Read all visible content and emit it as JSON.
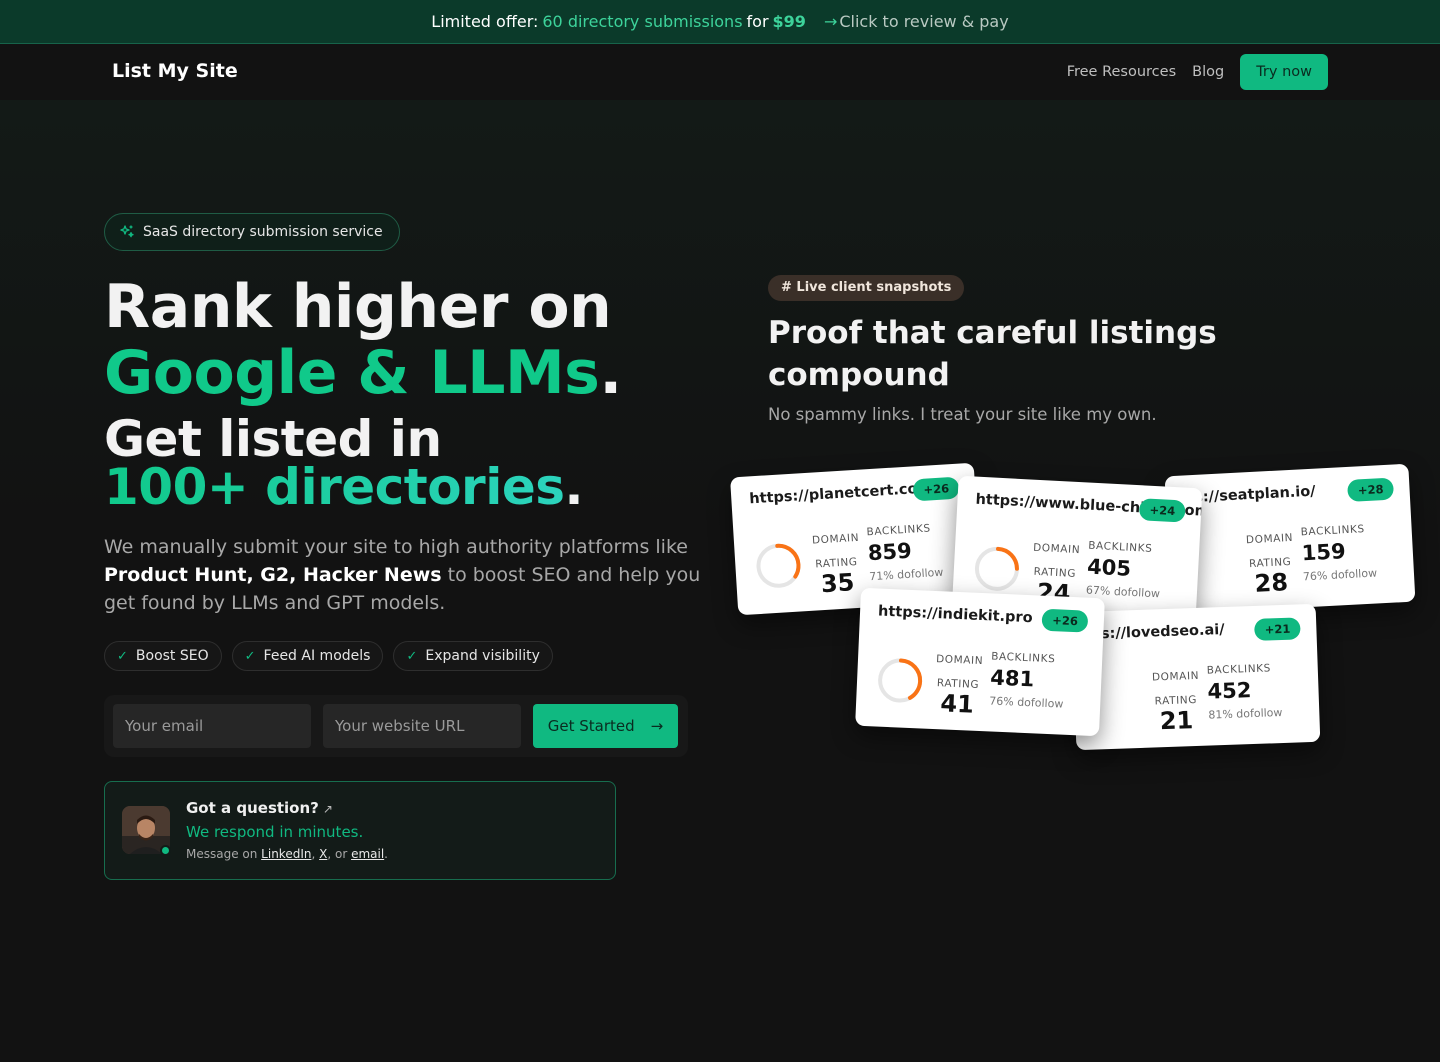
{
  "promo": {
    "prefix": "Limited offer:",
    "offer": "60 directory submissions",
    "for": "for",
    "price": "$99",
    "cta": "Click to review & pay"
  },
  "nav": {
    "brand": "List My Site",
    "links": [
      "Free Resources",
      "Blog"
    ],
    "cta": "Try now"
  },
  "hero": {
    "badge": "SaaS directory submission service",
    "headline_line1": "Rank higher on",
    "headline_line2": "Google & LLMs",
    "headline_line3": "Get listed in",
    "headline_line4": "100+ directories",
    "dot": ".",
    "desc_before": "We manually submit your site to high authority platforms like ",
    "desc_bold": "Product Hunt, G2, Hacker News",
    "desc_after": " to boost SEO and help you get found by LLMs and GPT models.",
    "pills": [
      "Boost SEO",
      "Feed AI models",
      "Expand visibility"
    ],
    "form": {
      "email_placeholder": "Your email",
      "url_placeholder": "Your website URL",
      "submit": "Get Started"
    }
  },
  "question": {
    "title": "Got a question?",
    "subtitle": "We respond in minutes.",
    "message_prefix": "Message on ",
    "link_linkedin": "LinkedIn",
    "sep1": ", ",
    "link_x": "X",
    "sep2": ", or ",
    "link_email": "email",
    "suffix": "."
  },
  "proof": {
    "badge": "# Live client snapshots",
    "title": "Proof that careful listings compound",
    "subtitle": "No spammy links. I treat your site like my own.",
    "labels": {
      "domain": "DOMAIN",
      "rating": "RATING",
      "backlinks": "BACKLINKS",
      "dofollow_suffix": "dofollow"
    },
    "cards": [
      {
        "url": "https://planetcert.com/",
        "delta": "+26",
        "rating": "35",
        "rating_fill": 0.35,
        "backlinks": "859",
        "dofollow": "71% dofollow"
      },
      {
        "url": "https://seatplan.io/",
        "delta": "+28",
        "rating": "28",
        "rating_fill": 0.28,
        "backlinks": "159",
        "dofollow": "76% dofollow"
      },
      {
        "url": "https://www.blue-chimp.com/",
        "delta": "+24",
        "rating": "24",
        "rating_fill": 0.24,
        "backlinks": "405",
        "dofollow": "67% dofollow"
      },
      {
        "url": "https://lovedseo.ai/",
        "delta": "+21",
        "rating": "21",
        "rating_fill": 0.21,
        "backlinks": "452",
        "dofollow": "81% dofollow"
      },
      {
        "url": "https://indiekit.pro",
        "delta": "+26",
        "rating": "41",
        "rating_fill": 0.41,
        "backlinks": "481",
        "dofollow": "76% dofollow"
      }
    ]
  },
  "colors": {
    "accent": "#10b981",
    "ring_track": "#e5e5e5",
    "ring_fill": "#f97316"
  }
}
